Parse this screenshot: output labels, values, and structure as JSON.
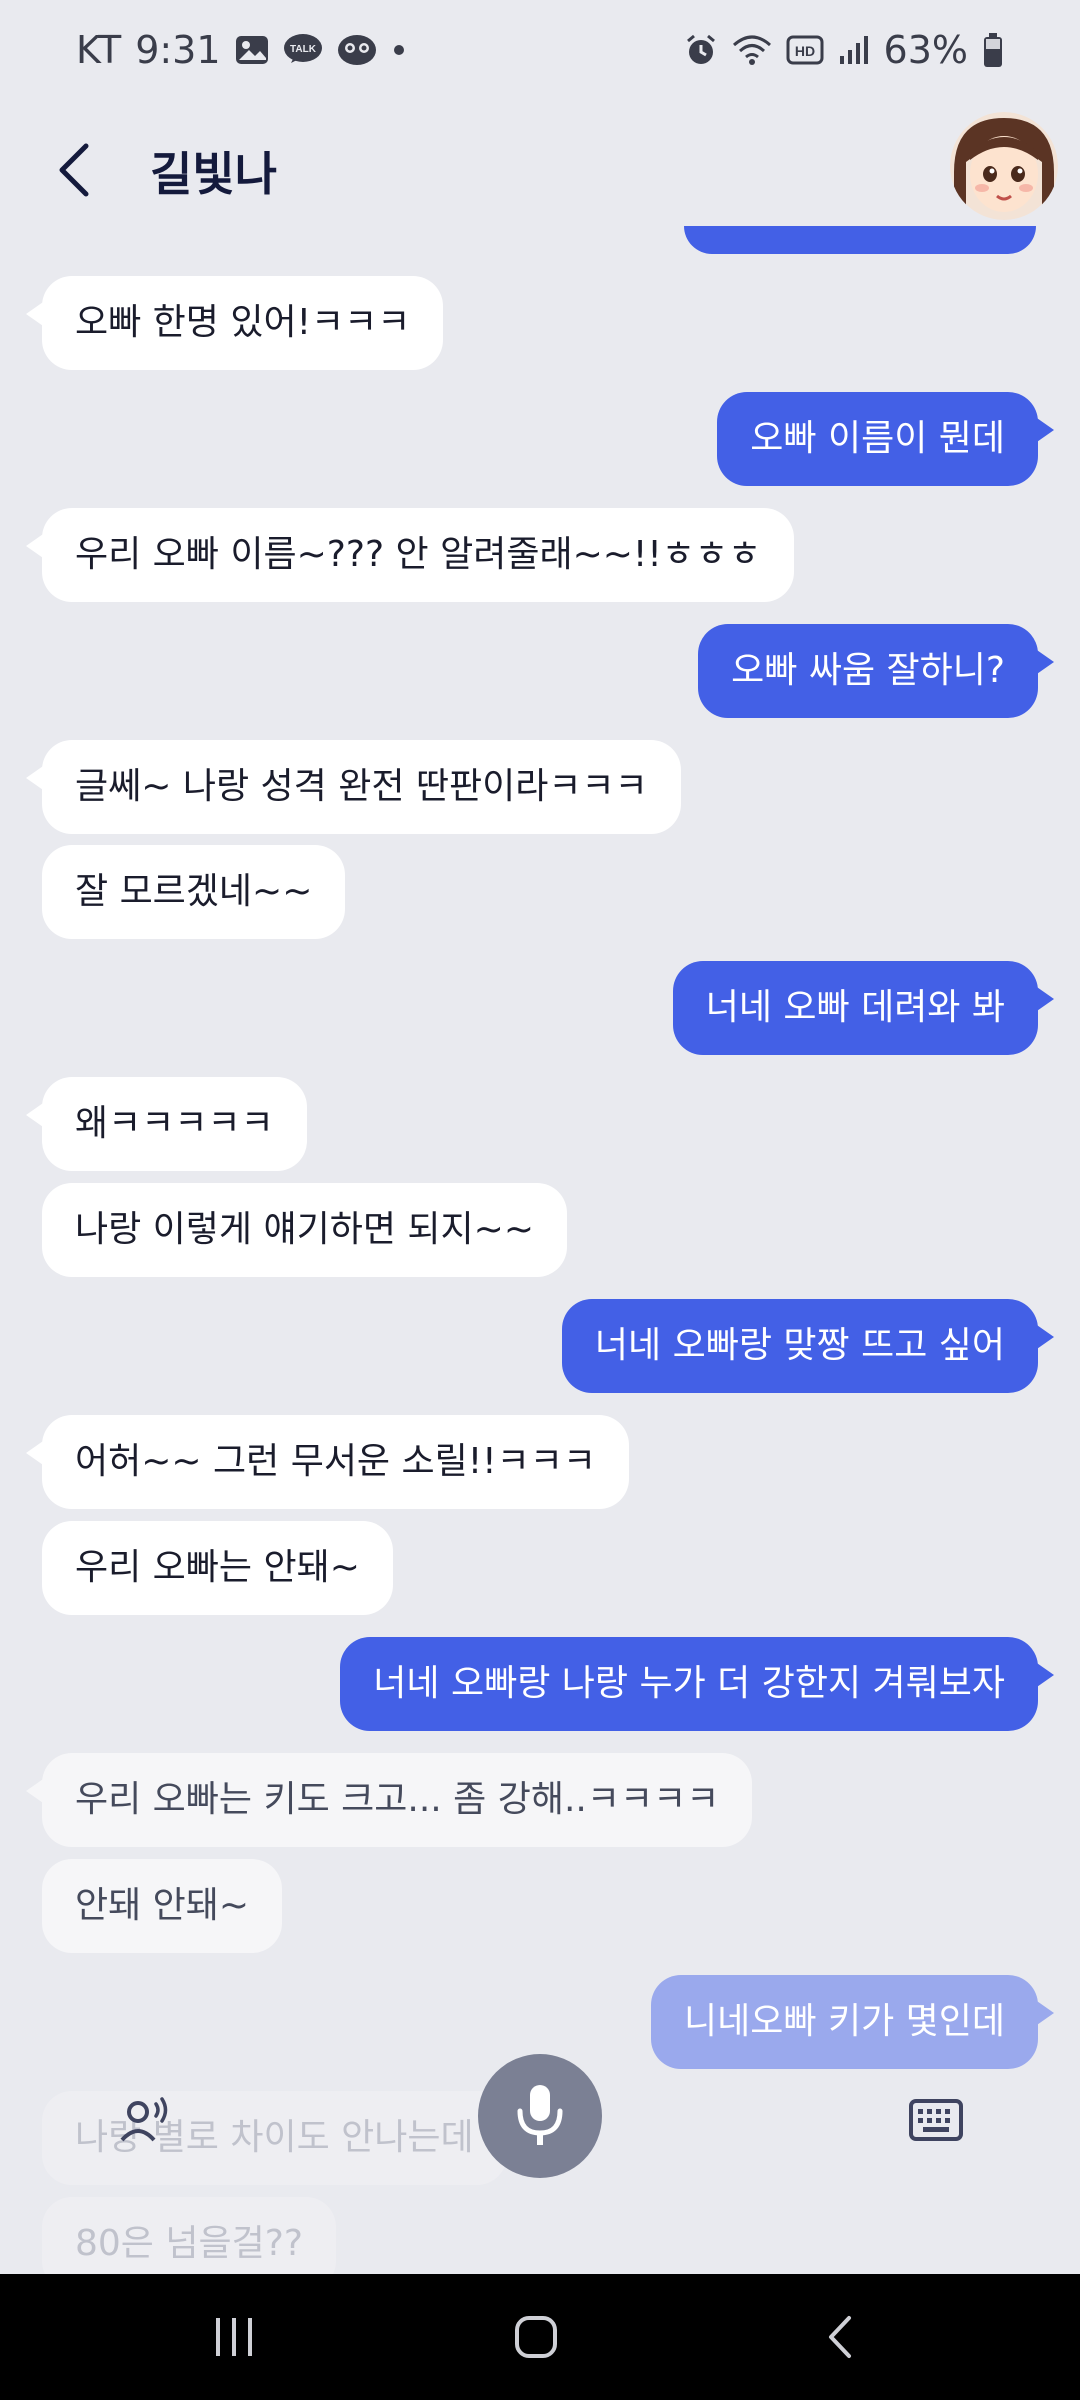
{
  "status_bar": {
    "carrier": "KT",
    "time": "9:31",
    "battery": "63%",
    "icons_left": [
      "image-icon",
      "kakaotalk-icon",
      "character-app-icon"
    ],
    "talk_badge": "TALK",
    "icons_right": [
      "alarm-icon",
      "wifi-icon",
      "hd-icon",
      "signal-icon",
      "battery-icon"
    ],
    "hd_label": "HD"
  },
  "header": {
    "title": "길빛나"
  },
  "messages": [
    {
      "from": "bot",
      "text": "오빠 한명 있어!ㅋㅋㅋ"
    },
    {
      "from": "user",
      "text": "오빠 이름이 뭔데"
    },
    {
      "from": "bot",
      "text": "우리 오빠 이름~??? 안 알려줄래~~!!ㅎㅎㅎ"
    },
    {
      "from": "user",
      "text": "오빠 싸움 잘하니?"
    },
    {
      "from": "bot",
      "text": "글쎄~ 나랑 성격 완전 딴판이라ㅋㅋㅋ"
    },
    {
      "from": "bot",
      "text": "잘 모르겠네~~"
    },
    {
      "from": "user",
      "text": "너네 오빠 데려와 봐"
    },
    {
      "from": "bot",
      "text": "왜ㅋㅋㅋㅋㅋ"
    },
    {
      "from": "bot",
      "text": "나랑 이렇게 얘기하면 되지~~"
    },
    {
      "from": "user",
      "text": "너네 오빠랑 맞짱 뜨고 싶어"
    },
    {
      "from": "bot",
      "text": "어허~~ 그런 무서운 소릴!!ㅋㅋㅋ"
    },
    {
      "from": "bot",
      "text": "우리 오빠는 안돼~"
    },
    {
      "from": "user",
      "text": "너네 오빠랑 나랑 누가 더 강한지 겨뤄보자"
    },
    {
      "from": "bot",
      "text": "우리 오빠는 키도 크고... 좀 강해..ㅋㅋㅋㅋ"
    },
    {
      "from": "bot",
      "text": "안돼 안돼~"
    },
    {
      "from": "user",
      "text": "니네오빠 키가 몇인데"
    },
    {
      "from": "bot",
      "text": "나랑 별로 차이도 안나는데"
    },
    {
      "from": "bot",
      "text": "80은 넘을걸??"
    }
  ],
  "colors": {
    "background": "#e9eaef",
    "sent_bubble": "#4360e6",
    "received_bubble": "#ffffff",
    "mic_button": "#7b8094"
  },
  "controls": {
    "left": "voice-person-icon",
    "center": "microphone-icon",
    "right": "keyboard-icon"
  },
  "nav": [
    "recent-apps-icon",
    "home-icon",
    "back-nav-icon"
  ]
}
